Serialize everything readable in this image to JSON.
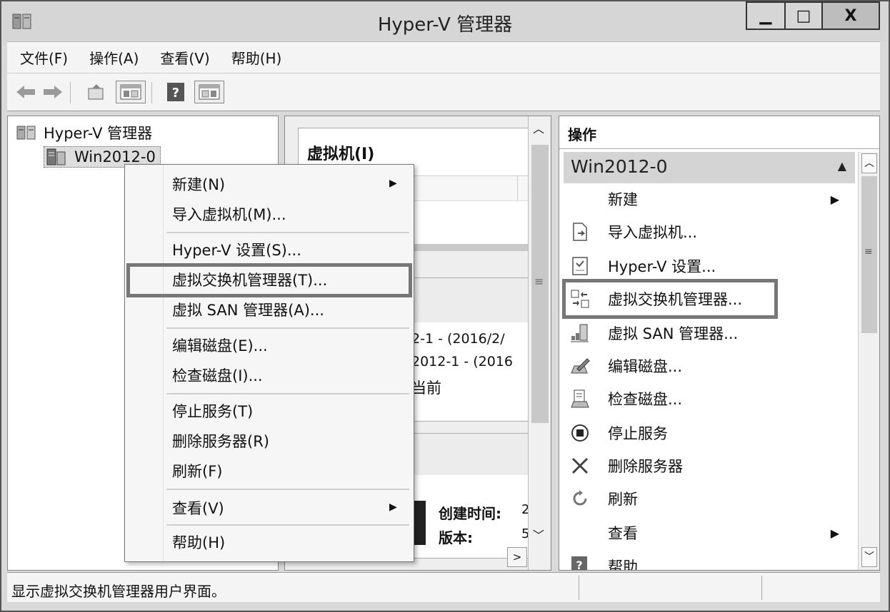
{
  "window": {
    "title": "Hyper-V 管理器",
    "min_glyph": "▁",
    "max_glyph": "□",
    "close_glyph": "X"
  },
  "menubar": {
    "items": [
      "文件(F)",
      "操作(A)",
      "查看(V)",
      "帮助(H)"
    ]
  },
  "tree": {
    "root": "Hyper-V 管理器",
    "server": "Win2012-0"
  },
  "center": {
    "vm_header": "虚拟机(I)",
    "snap_line1": "2-1 - (2016/2/",
    "snap_line2": "2012-1 - (2016",
    "snap_line3": "当前",
    "created_label": "创建时间:",
    "created_value": "2",
    "version_label": "版本:",
    "version_value": "5"
  },
  "context_menu": {
    "items": [
      {
        "label": "新建(N)",
        "submenu": true
      },
      {
        "label": "导入虚拟机(M)..."
      },
      {
        "label": "Hyper-V 设置(S)..."
      },
      {
        "label": "虚拟交换机管理器(T)..."
      },
      {
        "label": "虚拟 SAN 管理器(A)..."
      },
      {
        "label": "编辑磁盘(E)..."
      },
      {
        "label": "检查磁盘(I)..."
      },
      {
        "label": "停止服务(T)"
      },
      {
        "label": "删除服务器(R)"
      },
      {
        "label": "刷新(F)"
      },
      {
        "label": "查看(V)",
        "submenu": true
      },
      {
        "label": "帮助(H)"
      }
    ]
  },
  "actions": {
    "header": "操作",
    "group": "Win2012-0",
    "items": [
      {
        "label": "新建",
        "icon": "none"
      },
      {
        "label": "导入虚拟机...",
        "icon": "import-icon"
      },
      {
        "label": "Hyper-V 设置...",
        "icon": "settings-icon"
      },
      {
        "label": "虚拟交换机管理器...",
        "icon": "switch-icon"
      },
      {
        "label": "虚拟 SAN 管理器...",
        "icon": "san-icon"
      },
      {
        "label": "编辑磁盘...",
        "icon": "edit-disk-icon"
      },
      {
        "label": "检查磁盘...",
        "icon": "inspect-disk-icon"
      },
      {
        "label": "停止服务",
        "icon": "stop-icon"
      },
      {
        "label": "删除服务器",
        "icon": "delete-icon"
      },
      {
        "label": "刷新",
        "icon": "refresh-icon"
      },
      {
        "label": "查看",
        "icon": "none"
      },
      {
        "label": "帮助",
        "icon": "help-icon"
      }
    ]
  },
  "status": {
    "text": "显示虚拟交换机管理器用户界面。"
  }
}
